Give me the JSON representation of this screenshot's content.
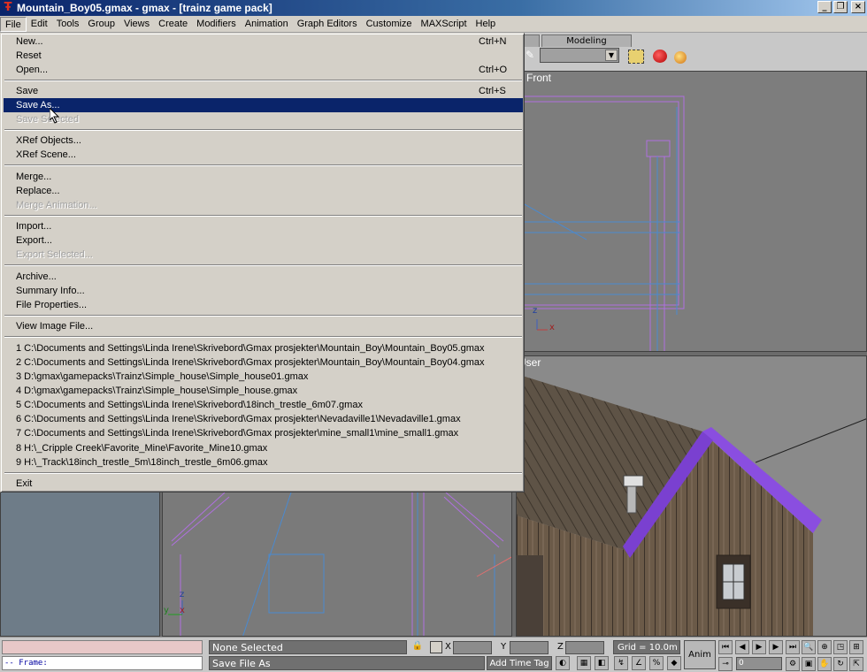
{
  "window": {
    "title": "Mountain_Boy05.gmax - gmax - [trainz game pack]"
  },
  "menubar": {
    "items": [
      "File",
      "Edit",
      "Tools",
      "Group",
      "Views",
      "Create",
      "Modifiers",
      "Animation",
      "Graph Editors",
      "Customize",
      "MAXScript",
      "Help"
    ]
  },
  "toolbar": {
    "tab_label": "Modeling"
  },
  "file_menu": {
    "new": {
      "label": "New...",
      "shortcut": "Ctrl+N"
    },
    "reset": {
      "label": "Reset"
    },
    "open": {
      "label": "Open...",
      "shortcut": "Ctrl+O"
    },
    "save": {
      "label": "Save",
      "shortcut": "Ctrl+S"
    },
    "save_as": {
      "label": "Save As..."
    },
    "save_selected": {
      "label": "Save Selected"
    },
    "xref_objects": {
      "label": "XRef Objects..."
    },
    "xref_scene": {
      "label": "XRef Scene..."
    },
    "merge": {
      "label": "Merge..."
    },
    "replace": {
      "label": "Replace..."
    },
    "merge_animation": {
      "label": "Merge Animation..."
    },
    "import": {
      "label": "Import..."
    },
    "export": {
      "label": "Export..."
    },
    "export_selected": {
      "label": "Export Selected..."
    },
    "archive": {
      "label": "Archive..."
    },
    "summary_info": {
      "label": "Summary Info..."
    },
    "file_properties": {
      "label": "File Properties..."
    },
    "view_image_file": {
      "label": "View Image File..."
    },
    "recent_files": [
      "1 C:\\Documents and Settings\\Linda Irene\\Skrivebord\\Gmax prosjekter\\Mountain_Boy\\Mountain_Boy05.gmax",
      "2 C:\\Documents and Settings\\Linda Irene\\Skrivebord\\Gmax prosjekter\\Mountain_Boy\\Mountain_Boy04.gmax",
      "3 D:\\gmax\\gamepacks\\Trainz\\Simple_house\\Simple_house01.gmax",
      "4 D:\\gmax\\gamepacks\\Trainz\\Simple_house\\Simple_house.gmax",
      "5 C:\\Documents and Settings\\Linda Irene\\Skrivebord\\18inch_trestle_6m07.gmax",
      "6 C:\\Documents and Settings\\Linda Irene\\Skrivebord\\Gmax prosjekter\\Nevadaville1\\Nevadaville1.gmax",
      "7 C:\\Documents and Settings\\Linda Irene\\Skrivebord\\Gmax prosjekter\\mine_small1\\mine_small1.gmax",
      "8 H:\\_Cripple Creek\\Favorite_Mine\\Favorite_Mine10.gmax",
      "9 H:\\_Track\\18inch_trestle_5m\\18inch_trestle_6m06.gmax"
    ],
    "exit": {
      "label": "Exit"
    }
  },
  "viewports": {
    "front": {
      "label": "Front"
    },
    "user": {
      "label": "User"
    },
    "left_axis": {
      "z": "z",
      "y": "y",
      "x": "x"
    },
    "front_axis": {
      "z": "z",
      "x": "x"
    }
  },
  "status": {
    "maxscript_output": "-- Frame:",
    "selection": "None Selected",
    "prompt": "Save File As",
    "x_label": "X",
    "y_label": "Y",
    "z_label": "Z",
    "grid": "Grid = 10.0m",
    "add_time_tag": "Add Time Tag",
    "anim": "Anim",
    "frame_value": "0"
  },
  "colors": {
    "title_start": "#0a246a",
    "title_end": "#a6caf0",
    "menu_bg": "#d4d0c8",
    "highlight": "#0a246a",
    "selection_wire": "#9b5fd6"
  }
}
